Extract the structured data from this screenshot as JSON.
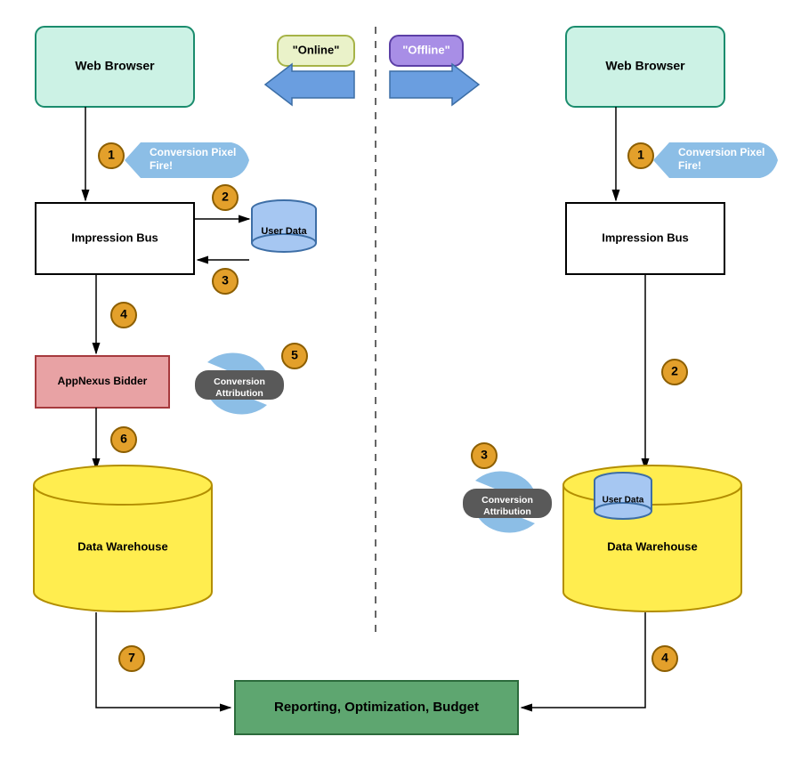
{
  "header": {
    "online_label": "\"Online\"",
    "offline_label": "\"Offline\""
  },
  "left": {
    "browser": "Web Browser",
    "pixel": "Conversion Pixel Fire!",
    "impression": "Impression Bus",
    "user_data": "User Data",
    "bidder": "AppNexus Bidder",
    "attribution": "Conversion Attribution",
    "warehouse": "Data Warehouse",
    "steps": {
      "s1": "1",
      "s2": "2",
      "s3": "3",
      "s4": "4",
      "s5": "5",
      "s6": "6",
      "s7": "7"
    }
  },
  "right": {
    "browser": "Web Browser",
    "pixel": "Conversion Pixel Fire!",
    "impression": "Impression Bus",
    "user_data": "User Data",
    "attribution": "Conversion Attribution",
    "warehouse": "Data Warehouse",
    "steps": {
      "s1": "1",
      "s2": "2",
      "s3": "3",
      "s4": "4"
    }
  },
  "footer": {
    "reporting": "Reporting, Optimization, Budget"
  },
  "colors": {
    "teal_fill": "#CCF2E5",
    "teal_stroke": "#1A8C6D",
    "cyl_fill": "#FFED4F",
    "cyl_stroke": "#B38E00",
    "blue_cyl_fill": "#A6C7F2",
    "blue_cyl_stroke": "#3D6EA6",
    "red_fill": "#E8A2A4",
    "red_stroke": "#A63A3D",
    "green_fill": "#5EA670",
    "green_stroke": "#2C6B3C",
    "step_fill": "#E3A02B",
    "step_stroke": "#8C5E00",
    "pill_fill": "#595959",
    "callout_fill": "#8CBEE6",
    "online_fill": "#EAF2C9",
    "online_stroke": "#A6B347",
    "offline_fill": "#A88EE6",
    "offline_stroke": "#5C3FA6",
    "arrow_fill": "#6A9EE0",
    "arrow_stroke": "#3C6EA6"
  }
}
